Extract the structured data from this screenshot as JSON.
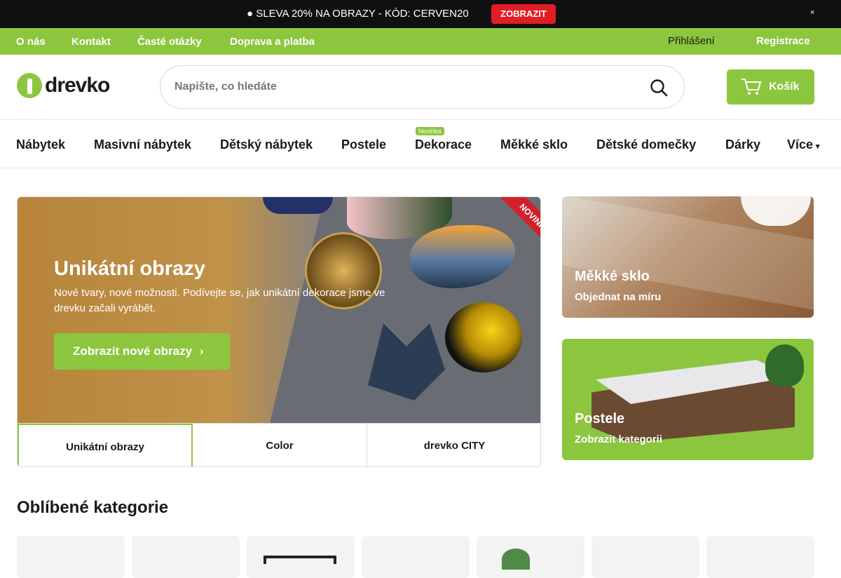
{
  "promo": {
    "text": "● SLEVA 20% NA OBRAZY - KÓD: CERVEN20",
    "button_label": "ZOBRAZIT",
    "close_label": "×"
  },
  "top_links": {
    "items": [
      "O nás",
      "Kontakt",
      "Časté otázky",
      "Doprava a platba"
    ],
    "login_label": "Přihlášení",
    "register_label": "Registrace"
  },
  "header": {
    "logo_text": "drevko",
    "search_placeholder": "Napište, co hledáte",
    "cart_label": "Košík"
  },
  "main_nav": {
    "items": [
      "Nábytek",
      "Masivní nábytek",
      "Dětský nábytek",
      "Postele",
      "Dekorace",
      "Měkké sklo",
      "Dětské domečky",
      "Dárky",
      "Více"
    ],
    "badge": "Novinka"
  },
  "hero": {
    "ribbon": "NOVINKA",
    "title": "Unikátní obrazy",
    "description": "Nové tvary, nové možnosti. Podívejte se, jak unikátní dekorace jsme ve drevku začali vyrábět.",
    "cta_label": "Zobrazit nové obrazy",
    "tabs": [
      "Unikátní obrazy",
      "Color",
      "drevko CITY"
    ]
  },
  "side_cards": {
    "glass": {
      "title": "Měkké sklo",
      "subtitle": "Objednat na míru"
    },
    "bed": {
      "title": "Postele",
      "subtitle": "Zobrazit kategorii"
    }
  },
  "popular": {
    "title": "Oblíbené kategorie"
  },
  "colors": {
    "accent": "#8cc63f",
    "promo_bar": "#101010",
    "promo_button": "#e11d25"
  }
}
